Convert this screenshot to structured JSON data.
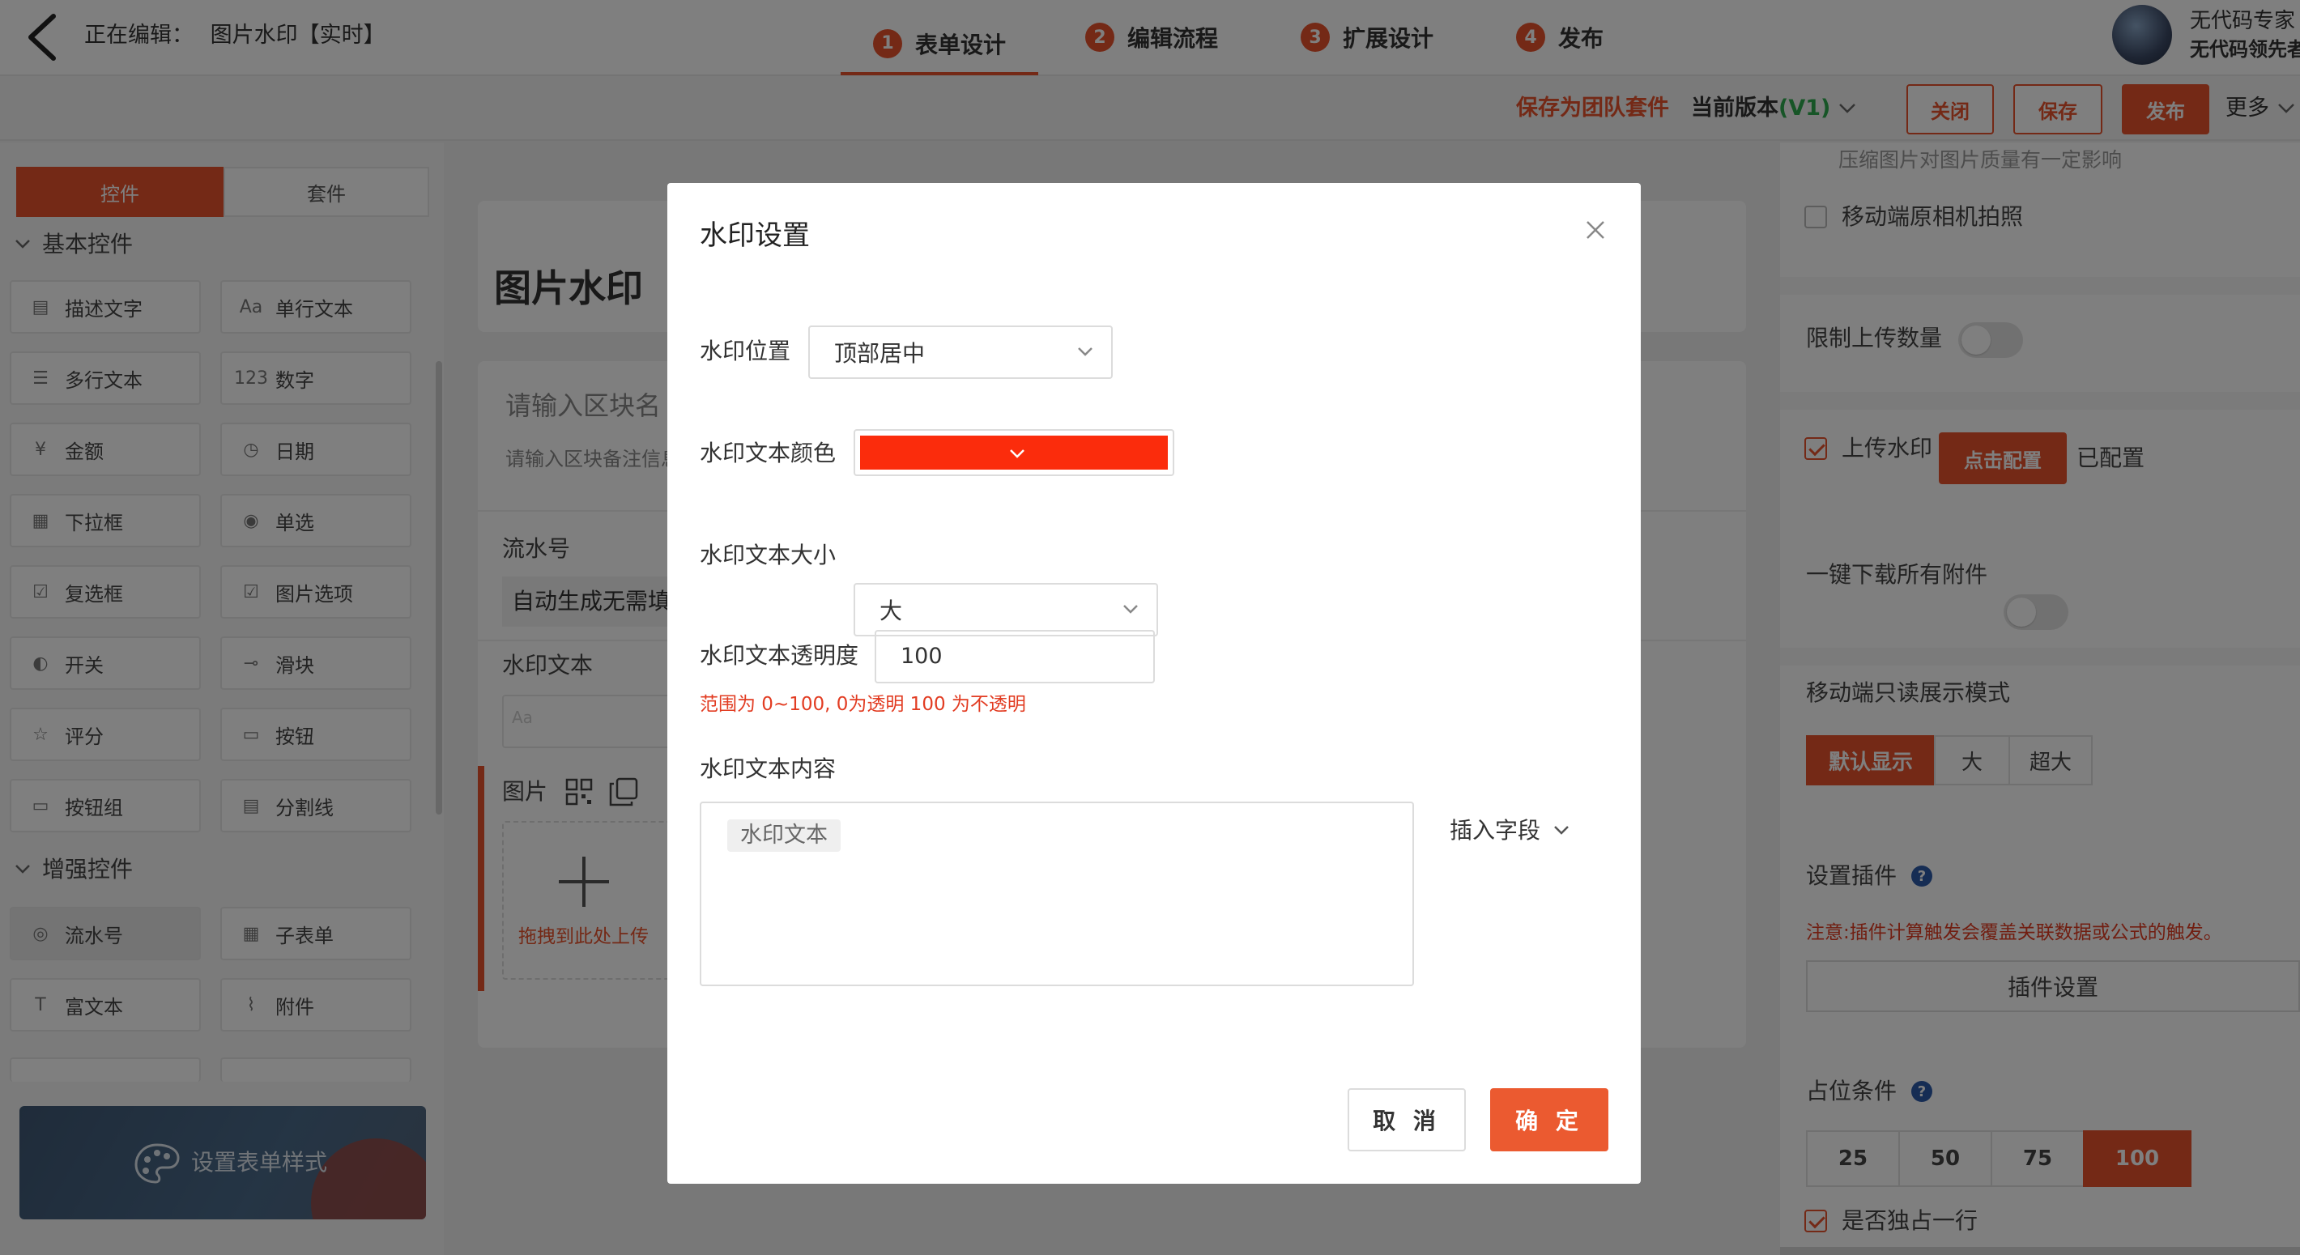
{
  "topbar": {
    "editing_label": "正在编辑：",
    "app_name": "图片水印【实时】",
    "steps": [
      {
        "num": "1",
        "label": "表单设计"
      },
      {
        "num": "2",
        "label": "编辑流程"
      },
      {
        "num": "3",
        "label": "扩展设计"
      },
      {
        "num": "4",
        "label": "发布"
      }
    ],
    "user_line1": "无代码专家",
    "user_line2": "无代码领先者"
  },
  "subbar": {
    "save_team": "保存为团队套件",
    "version_prefix": "当前版本",
    "version_value": "(V1)",
    "close": "关闭",
    "save": "保存",
    "publish": "发布",
    "more": "更多"
  },
  "left": {
    "tab_controls": "控件",
    "tab_suites": "套件",
    "section_basic": "基本控件",
    "section_enhanced": "增强控件",
    "basic": [
      {
        "label": "描述文字",
        "icon": "▤"
      },
      {
        "label": "单行文本",
        "icon": "Aa"
      },
      {
        "label": "多行文本",
        "icon": "☰"
      },
      {
        "label": "数字",
        "icon": "123"
      },
      {
        "label": "金额",
        "icon": "¥"
      },
      {
        "label": "日期",
        "icon": "◷"
      },
      {
        "label": "下拉框",
        "icon": "▦"
      },
      {
        "label": "单选",
        "icon": "◉"
      },
      {
        "label": "复选框",
        "icon": "☑"
      },
      {
        "label": "图片选项",
        "icon": "☑"
      },
      {
        "label": "开关",
        "icon": "◐"
      },
      {
        "label": "滑块",
        "icon": "⊸"
      },
      {
        "label": "评分",
        "icon": "☆"
      },
      {
        "label": "按钮",
        "icon": "▭"
      },
      {
        "label": "按钮组",
        "icon": "▭"
      },
      {
        "label": "分割线",
        "icon": "▤"
      }
    ],
    "enhanced": [
      {
        "label": "流水号",
        "icon": "◎"
      },
      {
        "label": "子表单",
        "icon": "▦"
      },
      {
        "label": "富文本",
        "icon": "T"
      },
      {
        "label": "附件",
        "icon": "⌇"
      }
    ],
    "style_button": "设置表单样式"
  },
  "canvas": {
    "form_title": "图片水印",
    "block_name": "请输入区块名",
    "block_note": "请输入区块备注信息",
    "serial_label": "流水号",
    "serial_value": "自动生成无需填写",
    "wm_label": "水印文本",
    "wm_placeholder": "Aa",
    "image_label": "图片",
    "upload_text": "拖拽到此处上传"
  },
  "right": {
    "compress_note": "压缩图片对图片质量有一定影响",
    "mobile_camera": "移动端原相机拍照",
    "limit_upload": "限制上传数量",
    "upload_wm": "上传水印",
    "click_config": "点击配置",
    "configured": "已配置",
    "download_all": "一键下载所有附件",
    "mobile_readonly": "移动端只读展示模式",
    "display_modes": [
      "默认显示",
      "大",
      "超大"
    ],
    "plugin_title": "设置插件",
    "plugin_note": "注意:插件计算触发会覆盖关联数据或公式的触发。",
    "plugin_btn": "插件设置",
    "width_title": "占位条件",
    "width_opts": [
      "25",
      "50",
      "75",
      "100"
    ],
    "own_row": "是否独占一行"
  },
  "modal": {
    "title": "水印设置",
    "pos_label": "水印位置",
    "pos_value": "顶部居中",
    "color_label": "水印文本颜色",
    "color_value": "#fb2c0c",
    "size_label": "水印文本大小",
    "size_value": "大",
    "opacity_label": "水印文本透明度",
    "opacity_value": "100",
    "opacity_hint": "范围为 0~100, 0为透明 100 为不透明",
    "content_label": "水印文本内容",
    "content_chip": "水印文本",
    "insert_field": "插入字段",
    "cancel": "取 消",
    "ok": "确 定"
  },
  "colors": {
    "accent": "#e8532d",
    "version_green": "#2eaa4f"
  }
}
